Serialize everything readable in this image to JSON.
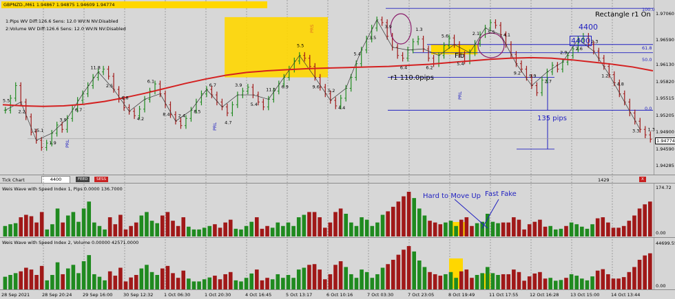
{
  "window": {
    "title": "GBPNZD.,M61  1.94867 1.94875 1.94609 1.94774",
    "indicator1": "1:Pips   WV Diff:126.6 Sens: 12.0 WV:N NV:Disabled",
    "indicator2": "2:Volume WV Diff:126.6 Sens: 12.0 WV:N NV:Disabled",
    "current_price": "1.94774",
    "rectangle_label": "Rectangle r1 On",
    "box_value": "4400",
    "box_value_2": "4400"
  },
  "toolbar": {
    "label": "Tick Chart",
    "input_value": "4400",
    "feed_label": "FEED",
    "sess_label": "SESS",
    "right_value": "1429",
    "close_label": "X"
  },
  "annotations": {
    "pips_label": "135 pips",
    "fib_label": "Fib",
    "r1_label": "r1 110.0pips",
    "fib_levels": [
      "100.0",
      "61.8",
      "50.0",
      "0.0"
    ],
    "hard_to_move": "Hard to Move Up",
    "fast_fake": "Fast Fake",
    "prl": "PRL",
    "prs": "PRS"
  },
  "wave_labels": [
    {
      "t": "5.5"
    },
    {
      "t": "2.2"
    },
    {
      "t": "15.1"
    },
    {
      "t": "1.9"
    },
    {
      "t": "3.9"
    },
    {
      "t": "6.7"
    },
    {
      "t": "11.8"
    },
    {
      "t": "2.5"
    },
    {
      "t": "6.8"
    },
    {
      "t": "4.2"
    },
    {
      "t": "6.1"
    },
    {
      "t": "8.4"
    },
    {
      "t": "2.4"
    },
    {
      "t": "8.5"
    },
    {
      "t": "6.7"
    },
    {
      "t": "4.7"
    },
    {
      "t": "3.9"
    },
    {
      "t": "5.4"
    },
    {
      "t": "11.5"
    },
    {
      "t": "6.9"
    },
    {
      "t": "5.5"
    },
    {
      "t": "9.6"
    },
    {
      "t": "5.2"
    },
    {
      "t": "4.4"
    },
    {
      "t": "5.4"
    },
    {
      "t": "3.5"
    },
    {
      "t": "3.9"
    },
    {
      "t": "6.4"
    },
    {
      "t": "1.3"
    },
    {
      "t": "6.2"
    },
    {
      "t": "5.6"
    },
    {
      "t": "5.4"
    },
    {
      "t": "2.1"
    },
    {
      "t": "5.5"
    },
    {
      "t": "4.1"
    },
    {
      "t": "9.2"
    },
    {
      "t": "9.9"
    },
    {
      "t": "2.7"
    },
    {
      "t": "2.9"
    },
    {
      "t": "2.6"
    },
    {
      "t": "2.3"
    },
    {
      "t": "1.2"
    },
    {
      "t": "4.8"
    },
    {
      "t": "3.3"
    },
    {
      "t": "1.3"
    }
  ],
  "chart_data": {
    "type": "bar",
    "title": "GBPNZD.,M61",
    "x_ticks": [
      "28 Sep 2021",
      "28 Sep 20:24",
      "29 Sep 16:00",
      "30 Sep 12:32",
      "1 Oct 06:30",
      "1 Oct 20:30",
      "4 Oct 16:45",
      "5 Oct 13:17",
      "6 Oct 10:16",
      "7 Oct 03:30",
      "7 Oct 23:05",
      "8 Oct 19:49",
      "11 Oct 17:55",
      "12 Oct 16:28",
      "13 Oct 15:00",
      "14 Oct 13:44"
    ],
    "price_axis": [
      "1.97060",
      "1.96590",
      "1.96130",
      "1.95820",
      "1.95515",
      "1.95205",
      "1.94900",
      "1.94590",
      "1.94285"
    ],
    "price_ylim": [
      1.9415,
      1.9725
    ],
    "price_series": [
      1.953,
      1.9552,
      1.9575,
      1.9545,
      1.9518,
      1.949,
      1.9475,
      1.9462,
      1.947,
      1.9488,
      1.9503,
      1.9495,
      1.9515,
      1.9532,
      1.9548,
      1.956,
      1.9575,
      1.959,
      1.96,
      1.9605,
      1.9592,
      1.9568,
      1.955,
      1.9535,
      1.9528,
      1.952,
      1.9532,
      1.955,
      1.9565,
      1.9578,
      1.956,
      1.954,
      1.9522,
      1.951,
      1.9502,
      1.9515,
      1.953,
      1.9545,
      1.956,
      1.9568,
      1.9558,
      1.9545,
      1.9536,
      1.9525,
      1.954,
      1.9558,
      1.9565,
      1.9572,
      1.9558,
      1.9545,
      1.9536,
      1.955,
      1.9565,
      1.9578,
      1.959,
      1.9605,
      1.962,
      1.963,
      1.9625,
      1.961,
      1.959,
      1.9572,
      1.956,
      1.9548,
      1.9538,
      1.9552,
      1.957,
      1.959,
      1.9615,
      1.964,
      1.966,
      1.968,
      1.9695,
      1.969,
      1.9665,
      1.9645,
      1.963,
      1.9625,
      1.964,
      1.9655,
      1.966,
      1.9642,
      1.9625,
      1.9615,
      1.963,
      1.9648,
      1.9662,
      1.965,
      1.9632,
      1.962,
      1.9635,
      1.9652,
      1.9668,
      1.968,
      1.969,
      1.9685,
      1.9668,
      1.965,
      1.9632,
      1.9615,
      1.9605,
      1.959,
      1.9575,
      1.9562,
      1.9585,
      1.96,
      1.9612,
      1.9605,
      1.9618,
      1.963,
      1.9642,
      1.966,
      1.9665,
      1.965,
      1.9638,
      1.9625,
      1.961,
      1.9595,
      1.958,
      1.956,
      1.9545,
      1.9525,
      1.951,
      1.9495,
      1.9485,
      1.9477
    ],
    "ma_series": [
      1.954,
      1.9538,
      1.9537,
      1.9538,
      1.9541,
      1.9546,
      1.9553,
      1.9561,
      1.957,
      1.9579,
      1.9587,
      1.9594,
      1.9599,
      1.9602,
      1.9604,
      1.9606,
      1.9607,
      1.9608,
      1.9609,
      1.961,
      1.9612,
      1.9614,
      1.9617,
      1.962,
      1.9623,
      1.9625,
      1.9626,
      1.9625,
      1.9622,
      1.9618,
      1.9614,
      1.9609,
      1.9602
    ],
    "volume_pips": [
      30,
      35,
      38,
      55,
      62,
      58,
      40,
      70,
      20,
      35,
      80,
      40,
      60,
      70,
      42,
      80,
      100,
      40,
      30,
      20,
      55,
      35,
      62,
      20,
      30,
      40,
      60,
      70,
      45,
      38,
      60,
      70,
      45,
      30,
      55,
      28,
      20,
      20,
      25,
      30,
      35,
      25,
      40,
      48,
      22,
      20,
      30,
      42,
      55,
      22,
      30,
      25,
      40,
      30,
      40,
      30,
      55,
      62,
      70,
      70,
      55,
      25,
      40,
      70,
      80,
      65,
      40,
      30,
      55,
      48,
      30,
      40,
      62,
      72,
      85,
      100,
      115,
      128,
      110,
      80,
      60,
      45,
      40,
      35,
      40,
      45,
      30,
      48,
      55,
      30,
      38,
      42,
      65,
      42,
      38,
      40,
      40,
      55,
      48,
      20,
      35,
      42,
      48,
      28,
      30,
      20,
      22,
      30,
      40,
      35,
      28,
      22,
      35,
      52,
      55,
      40,
      25,
      25,
      30,
      45,
      60,
      80,
      92,
      100
    ],
    "volume_volume": [
      35,
      40,
      45,
      50,
      60,
      55,
      40,
      65,
      25,
      40,
      75,
      42,
      58,
      68,
      45,
      78,
      95,
      42,
      35,
      25,
      50,
      38,
      60,
      22,
      33,
      40,
      58,
      68,
      48,
      40,
      58,
      65,
      45,
      32,
      52,
      30,
      22,
      22,
      28,
      33,
      38,
      28,
      42,
      48,
      25,
      22,
      32,
      44,
      55,
      25,
      32,
      28,
      42,
      32,
      40,
      32,
      55,
      60,
      68,
      70,
      55,
      28,
      42,
      68,
      78,
      62,
      42,
      32,
      55,
      48,
      32,
      42,
      60,
      70,
      82,
      96,
      110,
      120,
      105,
      80,
      62,
      48,
      42,
      38,
      42,
      48,
      32,
      50,
      55,
      32,
      40,
      45,
      62,
      45,
      40,
      42,
      42,
      55,
      48,
      24,
      36,
      44,
      48,
      30,
      32,
      24,
      26,
      32,
      42,
      38,
      30,
      25,
      36,
      52,
      56,
      42,
      30,
      30,
      34,
      48,
      62,
      82,
      94,
      100
    ],
    "volume_pips_axis": [
      "174.72",
      "0.00"
    ],
    "volume_volume_axis": [
      "44699.55",
      "0.00"
    ],
    "volume_titles": [
      "Weis Wave with Speed Index 1, Pips   0.0000 136.7000",
      "Weis Wave with Speed Index 2, Volume 0.00000 42571.0000"
    ]
  },
  "colors": {
    "up": "#1f8a1f",
    "down": "#a01818",
    "ma": "#d42020",
    "highlight": "#ffd700",
    "blue": "#1f1fc0"
  }
}
